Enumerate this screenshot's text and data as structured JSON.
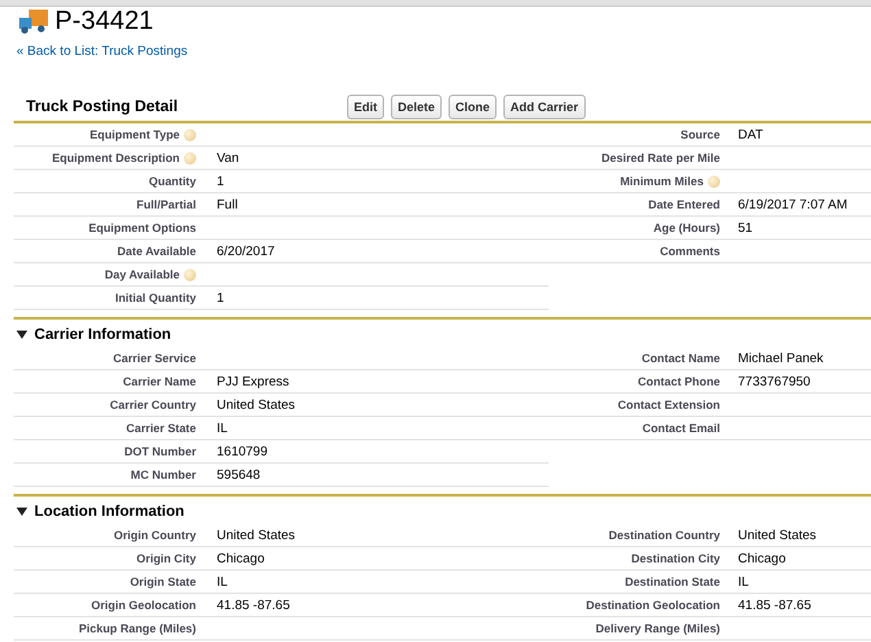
{
  "record": {
    "title": "P-34421",
    "back_link": "« Back to List: Truck Postings"
  },
  "detail": {
    "title": "Truck Posting Detail",
    "buttons": [
      "Edit",
      "Delete",
      "Clone",
      "Add Carrier"
    ]
  },
  "sections": [
    {
      "left": [
        {
          "label": "Equipment Type",
          "help": true
        },
        {
          "label": "Equipment Description",
          "value": "Van",
          "help": true
        },
        {
          "label": "Quantity",
          "value": "1"
        },
        {
          "label": "Full/Partial",
          "value": "Full"
        },
        {
          "label": "Equipment Options"
        },
        {
          "label": "Date Available",
          "value": "6/20/2017"
        },
        {
          "label": "Day Available",
          "help": true
        },
        {
          "label": "Initial Quantity",
          "value": "1"
        }
      ],
      "right": [
        {
          "label": "Source",
          "value": "DAT"
        },
        {
          "label": "Desired Rate per Mile"
        },
        {
          "label": "Minimum Miles",
          "help": true
        },
        {
          "label": "Date Entered",
          "value": "6/19/2017 7:07 AM"
        },
        {
          "label": "Age (Hours)",
          "value": "51"
        },
        {
          "label": "Comments"
        }
      ]
    },
    {
      "title": "Carrier Information",
      "left": [
        {
          "label": "Carrier Service"
        },
        {
          "label": "Carrier Name",
          "value": "PJJ Express"
        },
        {
          "label": "Carrier Country",
          "value": "United States"
        },
        {
          "label": "Carrier State",
          "value": "IL"
        },
        {
          "label": "DOT Number",
          "value": "1610799"
        },
        {
          "label": "MC Number",
          "value": "595648"
        }
      ],
      "right": [
        {
          "label": "Contact Name",
          "value": "Michael Panek"
        },
        {
          "label": "Contact Phone",
          "value": "7733767950"
        },
        {
          "label": "Contact Extension"
        },
        {
          "label": "Contact Email"
        }
      ]
    },
    {
      "title": "Location Information",
      "left": [
        {
          "label": "Origin Country",
          "value": "United States"
        },
        {
          "label": "Origin City",
          "value": "Chicago"
        },
        {
          "label": "Origin State",
          "value": "IL"
        },
        {
          "label": "Origin Geolocation",
          "value": "41.85 -87.65"
        },
        {
          "label": "Pickup Range (Miles)"
        }
      ],
      "right": [
        {
          "label": "Destination Country",
          "value": "United States"
        },
        {
          "label": "Destination City",
          "value": "Chicago"
        },
        {
          "label": "Destination State",
          "value": "IL"
        },
        {
          "label": "Destination Geolocation",
          "value": "41.85 -87.65"
        },
        {
          "label": "Delivery Range (Miles)"
        }
      ]
    }
  ]
}
